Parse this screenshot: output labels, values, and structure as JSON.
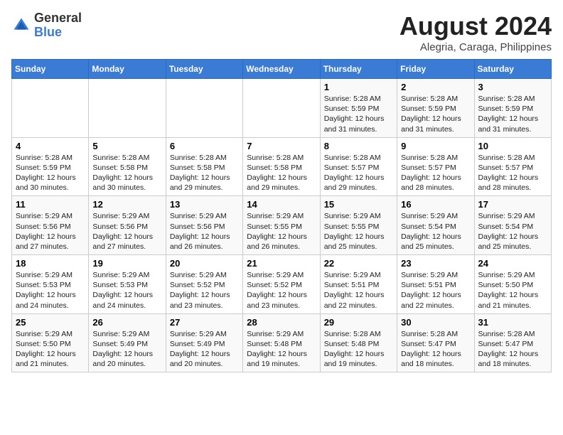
{
  "header": {
    "logo_general": "General",
    "logo_blue": "Blue",
    "month_year": "August 2024",
    "location": "Alegria, Caraga, Philippines"
  },
  "weekdays": [
    "Sunday",
    "Monday",
    "Tuesday",
    "Wednesday",
    "Thursday",
    "Friday",
    "Saturday"
  ],
  "weeks": [
    [
      {
        "day": "",
        "info": ""
      },
      {
        "day": "",
        "info": ""
      },
      {
        "day": "",
        "info": ""
      },
      {
        "day": "",
        "info": ""
      },
      {
        "day": "1",
        "info": "Sunrise: 5:28 AM\nSunset: 5:59 PM\nDaylight: 12 hours\nand 31 minutes."
      },
      {
        "day": "2",
        "info": "Sunrise: 5:28 AM\nSunset: 5:59 PM\nDaylight: 12 hours\nand 31 minutes."
      },
      {
        "day": "3",
        "info": "Sunrise: 5:28 AM\nSunset: 5:59 PM\nDaylight: 12 hours\nand 31 minutes."
      }
    ],
    [
      {
        "day": "4",
        "info": "Sunrise: 5:28 AM\nSunset: 5:59 PM\nDaylight: 12 hours\nand 30 minutes."
      },
      {
        "day": "5",
        "info": "Sunrise: 5:28 AM\nSunset: 5:58 PM\nDaylight: 12 hours\nand 30 minutes."
      },
      {
        "day": "6",
        "info": "Sunrise: 5:28 AM\nSunset: 5:58 PM\nDaylight: 12 hours\nand 29 minutes."
      },
      {
        "day": "7",
        "info": "Sunrise: 5:28 AM\nSunset: 5:58 PM\nDaylight: 12 hours\nand 29 minutes."
      },
      {
        "day": "8",
        "info": "Sunrise: 5:28 AM\nSunset: 5:57 PM\nDaylight: 12 hours\nand 29 minutes."
      },
      {
        "day": "9",
        "info": "Sunrise: 5:28 AM\nSunset: 5:57 PM\nDaylight: 12 hours\nand 28 minutes."
      },
      {
        "day": "10",
        "info": "Sunrise: 5:28 AM\nSunset: 5:57 PM\nDaylight: 12 hours\nand 28 minutes."
      }
    ],
    [
      {
        "day": "11",
        "info": "Sunrise: 5:29 AM\nSunset: 5:56 PM\nDaylight: 12 hours\nand 27 minutes."
      },
      {
        "day": "12",
        "info": "Sunrise: 5:29 AM\nSunset: 5:56 PM\nDaylight: 12 hours\nand 27 minutes."
      },
      {
        "day": "13",
        "info": "Sunrise: 5:29 AM\nSunset: 5:56 PM\nDaylight: 12 hours\nand 26 minutes."
      },
      {
        "day": "14",
        "info": "Sunrise: 5:29 AM\nSunset: 5:55 PM\nDaylight: 12 hours\nand 26 minutes."
      },
      {
        "day": "15",
        "info": "Sunrise: 5:29 AM\nSunset: 5:55 PM\nDaylight: 12 hours\nand 25 minutes."
      },
      {
        "day": "16",
        "info": "Sunrise: 5:29 AM\nSunset: 5:54 PM\nDaylight: 12 hours\nand 25 minutes."
      },
      {
        "day": "17",
        "info": "Sunrise: 5:29 AM\nSunset: 5:54 PM\nDaylight: 12 hours\nand 25 minutes."
      }
    ],
    [
      {
        "day": "18",
        "info": "Sunrise: 5:29 AM\nSunset: 5:53 PM\nDaylight: 12 hours\nand 24 minutes."
      },
      {
        "day": "19",
        "info": "Sunrise: 5:29 AM\nSunset: 5:53 PM\nDaylight: 12 hours\nand 24 minutes."
      },
      {
        "day": "20",
        "info": "Sunrise: 5:29 AM\nSunset: 5:52 PM\nDaylight: 12 hours\nand 23 minutes."
      },
      {
        "day": "21",
        "info": "Sunrise: 5:29 AM\nSunset: 5:52 PM\nDaylight: 12 hours\nand 23 minutes."
      },
      {
        "day": "22",
        "info": "Sunrise: 5:29 AM\nSunset: 5:51 PM\nDaylight: 12 hours\nand 22 minutes."
      },
      {
        "day": "23",
        "info": "Sunrise: 5:29 AM\nSunset: 5:51 PM\nDaylight: 12 hours\nand 22 minutes."
      },
      {
        "day": "24",
        "info": "Sunrise: 5:29 AM\nSunset: 5:50 PM\nDaylight: 12 hours\nand 21 minutes."
      }
    ],
    [
      {
        "day": "25",
        "info": "Sunrise: 5:29 AM\nSunset: 5:50 PM\nDaylight: 12 hours\nand 21 minutes."
      },
      {
        "day": "26",
        "info": "Sunrise: 5:29 AM\nSunset: 5:49 PM\nDaylight: 12 hours\nand 20 minutes."
      },
      {
        "day": "27",
        "info": "Sunrise: 5:29 AM\nSunset: 5:49 PM\nDaylight: 12 hours\nand 20 minutes."
      },
      {
        "day": "28",
        "info": "Sunrise: 5:29 AM\nSunset: 5:48 PM\nDaylight: 12 hours\nand 19 minutes."
      },
      {
        "day": "29",
        "info": "Sunrise: 5:28 AM\nSunset: 5:48 PM\nDaylight: 12 hours\nand 19 minutes."
      },
      {
        "day": "30",
        "info": "Sunrise: 5:28 AM\nSunset: 5:47 PM\nDaylight: 12 hours\nand 18 minutes."
      },
      {
        "day": "31",
        "info": "Sunrise: 5:28 AM\nSunset: 5:47 PM\nDaylight: 12 hours\nand 18 minutes."
      }
    ]
  ]
}
